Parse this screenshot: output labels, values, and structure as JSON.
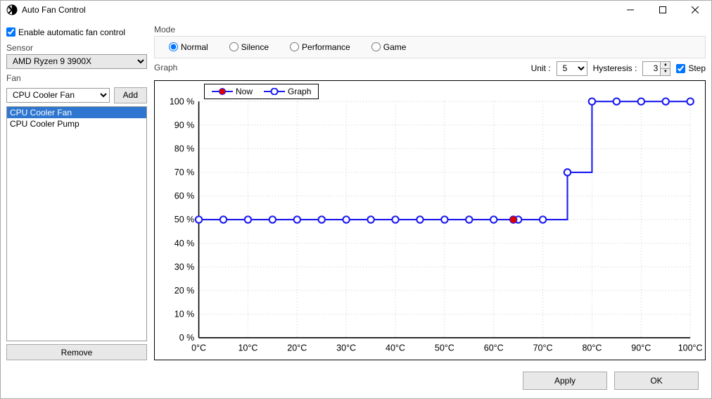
{
  "window": {
    "title": "Auto Fan Control"
  },
  "enable": {
    "label": "Enable automatic fan control",
    "checked": true
  },
  "sensor": {
    "label": "Sensor",
    "value": "AMD Ryzen 9 3900X"
  },
  "fan": {
    "label": "Fan",
    "selected": "CPU Cooler Fan",
    "add": "Add",
    "list": [
      "CPU Cooler Fan",
      "CPU Cooler Pump"
    ],
    "selected_index": 0,
    "remove": "Remove"
  },
  "mode": {
    "label": "Mode",
    "options": [
      "Normal",
      "Silence",
      "Performance",
      "Game"
    ],
    "selected": "Normal"
  },
  "graph": {
    "label": "Graph",
    "unit_label": "Unit :",
    "unit_value": "5",
    "hysteresis_label": "Hysteresis :",
    "hysteresis_value": "3",
    "step_label": "Step",
    "step_checked": true,
    "legend_now": "Now",
    "legend_graph": "Graph"
  },
  "buttons": {
    "apply": "Apply",
    "ok": "OK"
  },
  "chart_data": {
    "type": "line",
    "x": [
      0,
      5,
      10,
      15,
      20,
      25,
      30,
      35,
      40,
      45,
      50,
      55,
      60,
      65,
      70,
      75,
      80,
      85,
      90,
      95,
      100
    ],
    "values": [
      50,
      50,
      50,
      50,
      50,
      50,
      50,
      50,
      50,
      50,
      50,
      50,
      50,
      50,
      50,
      70,
      100,
      100,
      100,
      100,
      100
    ],
    "now": {
      "x": 64,
      "y": 50
    },
    "xlabel": "°C",
    "ylabel": "%",
    "xlim": [
      0,
      100
    ],
    "ylim": [
      0,
      100
    ],
    "xticks": [
      0,
      10,
      20,
      30,
      40,
      50,
      60,
      70,
      80,
      90,
      100
    ],
    "yticks": [
      0,
      10,
      20,
      30,
      40,
      50,
      60,
      70,
      80,
      90,
      100
    ],
    "step": true
  }
}
